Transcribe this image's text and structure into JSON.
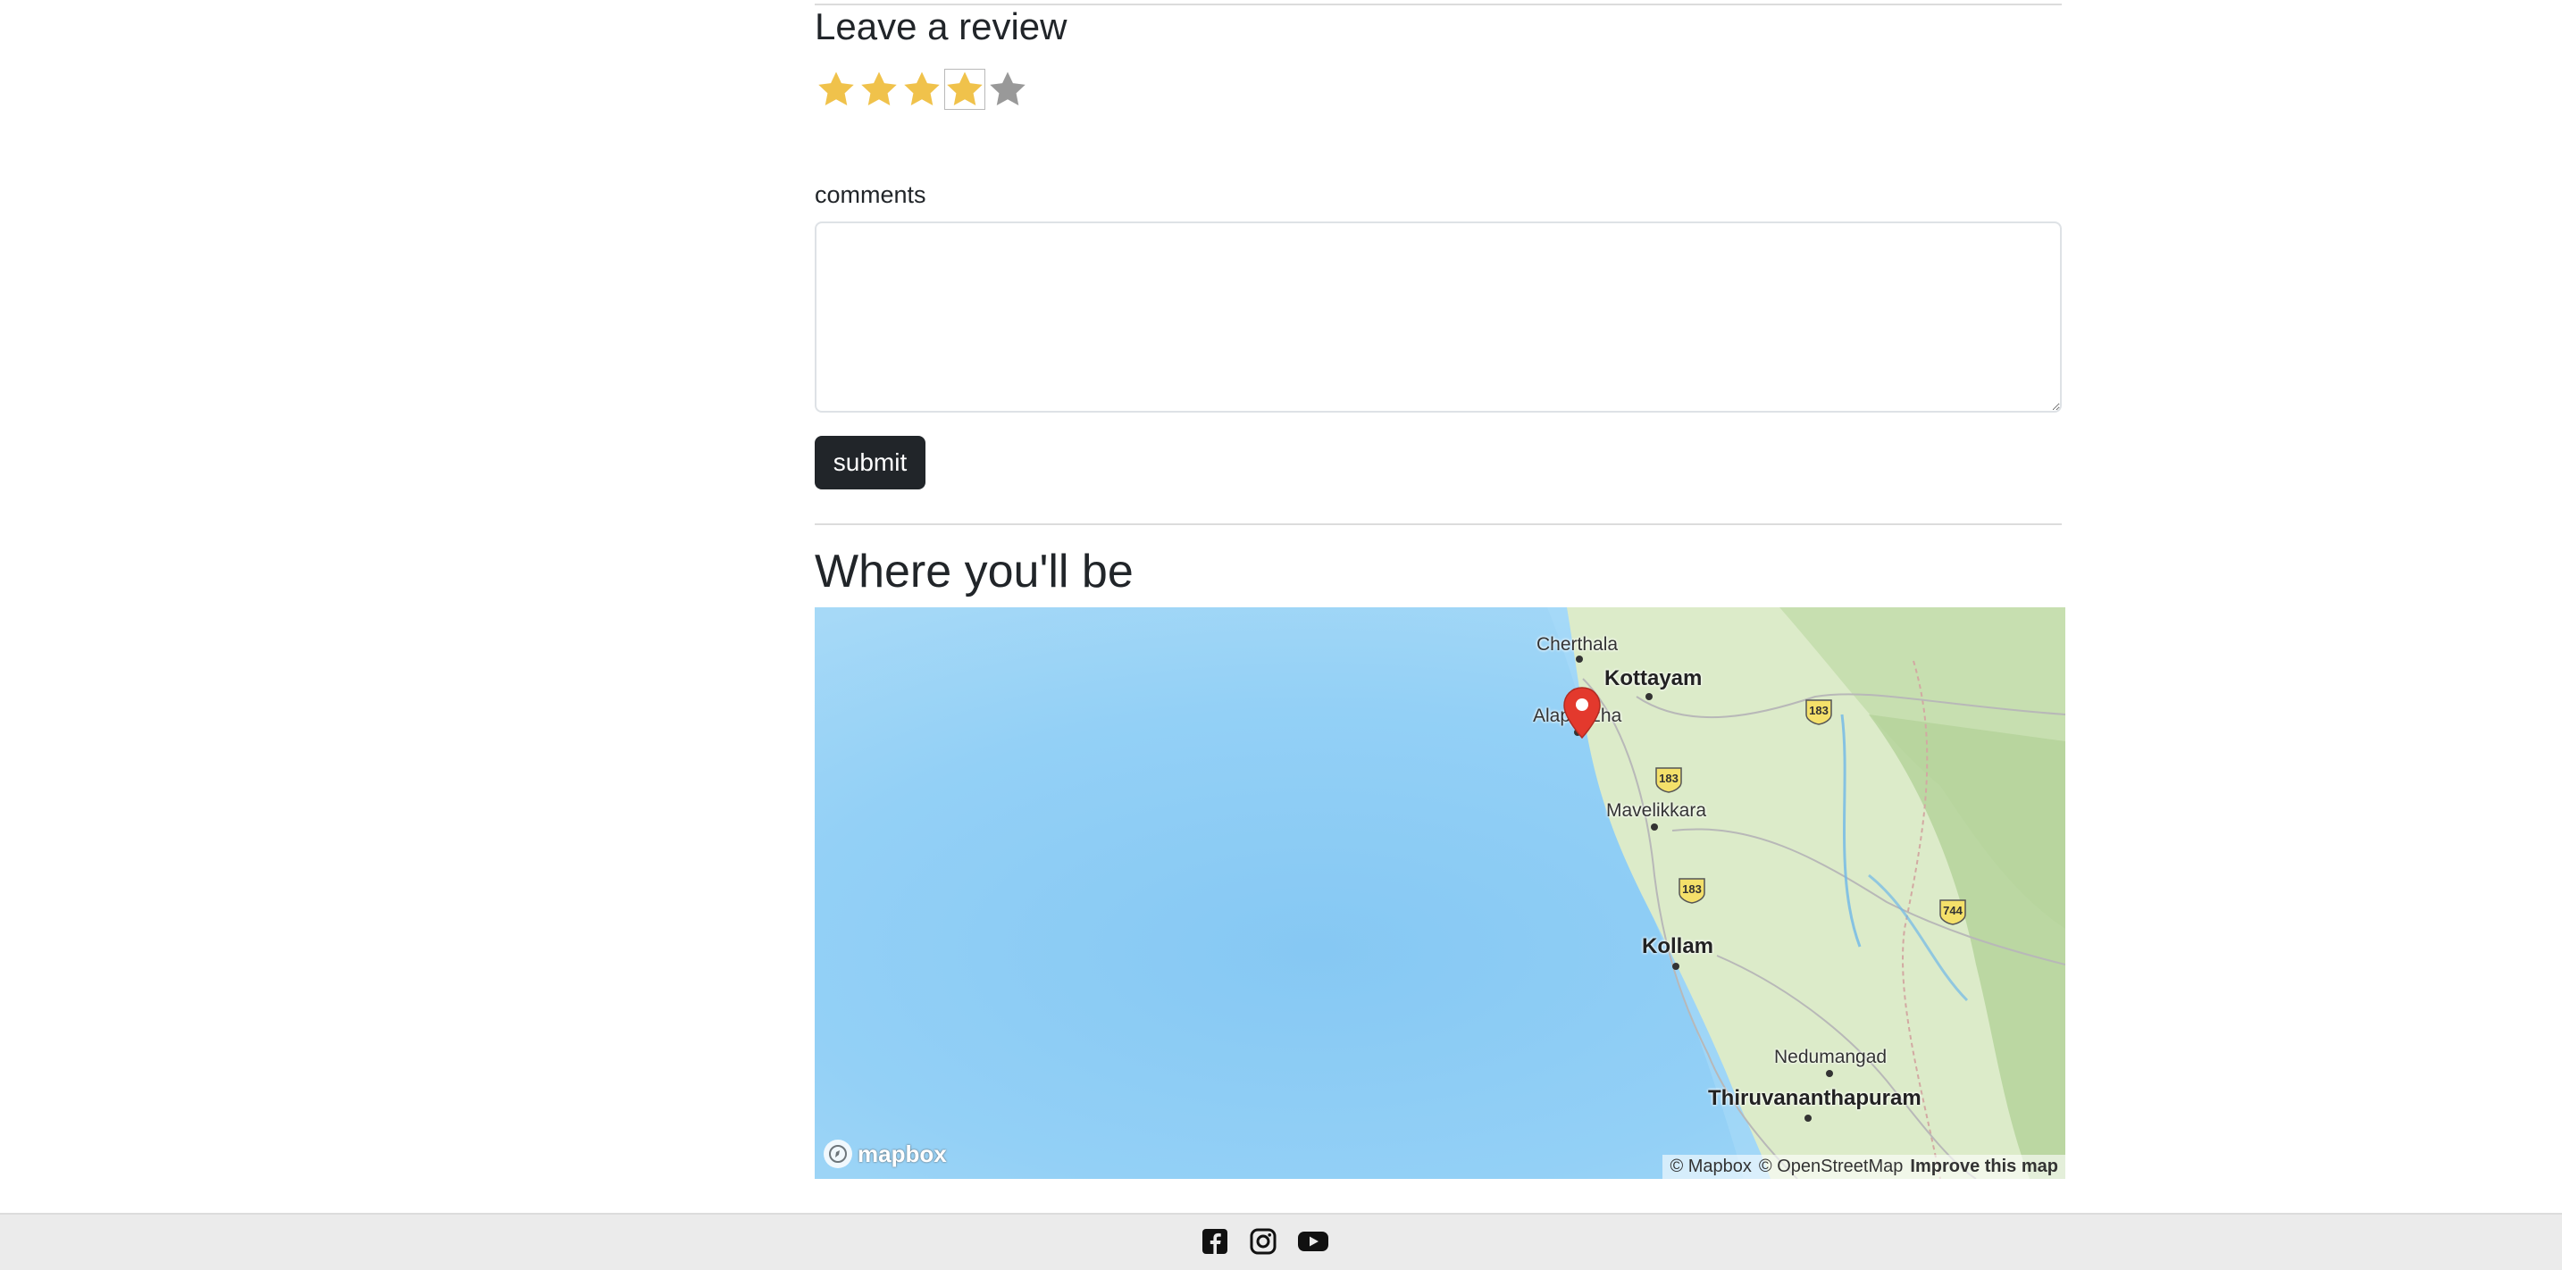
{
  "review": {
    "heading": "Leave a review",
    "rating": 4,
    "max_rating": 5,
    "comments_label": "comments",
    "comments_value": "",
    "submit_label": "submit"
  },
  "location": {
    "heading": "Where you'll be",
    "map": {
      "cities": [
        {
          "key": "cherthala",
          "name": "Cherthala"
        },
        {
          "key": "kottayam",
          "name": "Kottayam"
        },
        {
          "key": "alappuzha",
          "name": "Alappuzha"
        },
        {
          "key": "mavelikkara",
          "name": "Mavelikkara"
        },
        {
          "key": "kollam",
          "name": "Kollam"
        },
        {
          "key": "nedumangad",
          "name": "Nedumangad"
        },
        {
          "key": "thiruvananthapuram",
          "name": "Thiruvananthapuram"
        }
      ],
      "highway_shields": [
        "183",
        "183",
        "183",
        "744"
      ],
      "logo": "mapbox",
      "attribution": {
        "mapbox": "© Mapbox",
        "osm": "© OpenStreetMap",
        "improve": "Improve this map"
      },
      "marker_color": "#e3392d"
    }
  },
  "footer": {
    "icons": [
      "facebook-icon",
      "instagram-icon",
      "youtube-icon"
    ]
  },
  "colors": {
    "star_filled": "#f0c24b",
    "star_empty": "#999999",
    "button_bg": "#212529",
    "water": "#8fcdf5",
    "land": "#dcebc9"
  }
}
